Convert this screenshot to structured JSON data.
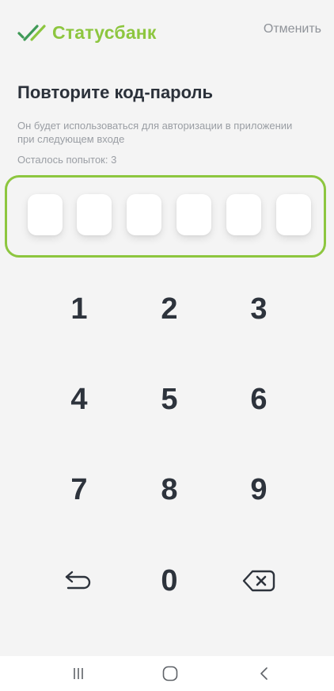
{
  "header": {
    "brand_name": "Статусбанк",
    "cancel_label": "Отменить"
  },
  "main": {
    "title": "Повторите код-пароль",
    "subtitle": "Он будет использоваться для авторизации в приложении при следующем входе",
    "attempts": "Осталось попыток: 3"
  },
  "code": {
    "length": 6,
    "filled": 0
  },
  "keypad": {
    "keys": [
      "1",
      "2",
      "3",
      "4",
      "5",
      "6",
      "7",
      "8",
      "9",
      "0"
    ],
    "back_icon": "back-arrow-icon",
    "delete_icon": "backspace-icon"
  },
  "navbar": {
    "icons": [
      "recent-apps-icon",
      "home-icon",
      "back-icon"
    ]
  },
  "colors": {
    "accent": "#8dc63f",
    "accent_dark": "#3f9a57",
    "background": "#f4f4f4",
    "text": "#2b313a",
    "muted": "#9a9ea4"
  }
}
